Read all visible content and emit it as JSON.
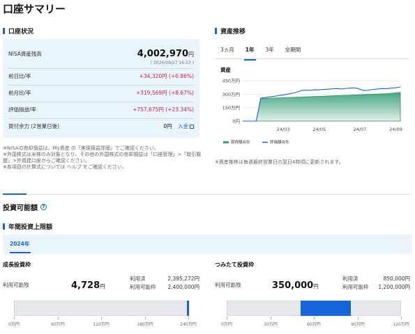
{
  "page_title": "口座サマリー",
  "account": {
    "heading": "口座状況",
    "nisa_label": "NISA資産残高",
    "nisa_value": "4,002,970",
    "nisa_unit": "円",
    "timestamp": "( 2024/09/27 16:53 )",
    "rows": [
      {
        "label": "前日比/率",
        "value": "+34,320円 (+0.86%)"
      },
      {
        "label": "前月比/率",
        "value": "+319,569円 (+8.67%)"
      },
      {
        "label": "評価損益/率",
        "value": "+757,675円 (+23.34%)"
      }
    ],
    "buying_power_label": "買付余力 (2営業日後)",
    "buying_power_value": "0円",
    "deposit_link": "入金",
    "notes": [
      "※NISAの売却損益は、My資産 の「実現損益詳細」でご確認ください。",
      "※外国株式は米株のみ対象となり、その他の外国株式の売却損益は「口座管理」>「取引履歴」>外貨建口座からご確認ください。",
      "※各項目の計算式については ヘルプ をご確認ください。"
    ]
  },
  "trend": {
    "heading": "資産推移",
    "tabs": [
      "3ヵ月",
      "1年",
      "3年",
      "全期間"
    ],
    "active_tab": "1年",
    "note": "※資産推移は毎週最終営業日の翌日4時頃に更新されます。"
  },
  "chart_data": {
    "type": "area",
    "ylabel": "資産",
    "yticks": [
      "450万円",
      "300万円",
      "150万円",
      "0円"
    ],
    "ylim": [
      0,
      450
    ],
    "xticks": [
      "24/03",
      "24/05",
      "24/07",
      "24/09"
    ],
    "x": [
      "24/01a",
      "24/01b",
      "24/01c",
      "24/01d",
      "24/02a",
      "24/02b",
      "24/02c",
      "24/02d",
      "24/03a",
      "24/03b",
      "24/03c",
      "24/03d",
      "24/04a",
      "24/04b",
      "24/04c",
      "24/04d",
      "24/05a",
      "24/05b",
      "24/05c",
      "24/05d",
      "24/06a",
      "24/06b",
      "24/06c",
      "24/06d",
      "24/07a",
      "24/07b",
      "24/07c",
      "24/07d",
      "24/08a",
      "24/08b",
      "24/08c",
      "24/08d",
      "24/09a",
      "24/09b",
      "24/09c",
      "24/09d"
    ],
    "series": [
      {
        "name": "取得額合計",
        "color": "#3aa37a",
        "values": [
          0,
          0,
          0,
          0,
          250,
          252,
          255,
          257,
          258,
          260,
          262,
          264,
          266,
          268,
          270,
          272,
          274,
          276,
          278,
          280,
          282,
          284,
          286,
          288,
          290,
          292,
          294,
          296,
          298,
          300,
          302,
          304,
          306,
          310,
          315,
          320
        ]
      },
      {
        "name": "評価額合計",
        "color": "#1565d8",
        "values": [
          0,
          0,
          0,
          0,
          255,
          262,
          270,
          276,
          285,
          292,
          300,
          310,
          322,
          340,
          345,
          342,
          350,
          348,
          352,
          355,
          360,
          362,
          358,
          365,
          368,
          370,
          355,
          340,
          345,
          352,
          358,
          362,
          360,
          368,
          372,
          380
        ]
      }
    ],
    "legend": "bottom"
  },
  "investable": {
    "heading": "投資可能額",
    "sub_heading": "年間投資上限額",
    "year_tab": "2024年",
    "growth": {
      "heading": "成長投資枠",
      "available_label": "利用可能残",
      "available_value": "4,728",
      "unit": "円",
      "used_label": "利用済",
      "used_value": "2,395,272円",
      "limit_label": "利用可能枠",
      "limit_value": "2,400,000円",
      "used_fraction": 0.998,
      "ticks": [
        "0万円",
        "60万円",
        "120万円",
        "180万円",
        "240万円"
      ]
    },
    "tsumitate": {
      "heading": "つみたて投資枠",
      "available_label": "利用可能残",
      "available_value": "350,000",
      "unit": "円",
      "used_label": "利用済",
      "used_value": "850,000円",
      "limit_label": "利用可能枠",
      "limit_value": "1,200,000円",
      "used_fraction": 0.708,
      "ticks": [
        "0万円",
        "30万円",
        "60万円",
        "90万円",
        "120万円"
      ]
    }
  }
}
